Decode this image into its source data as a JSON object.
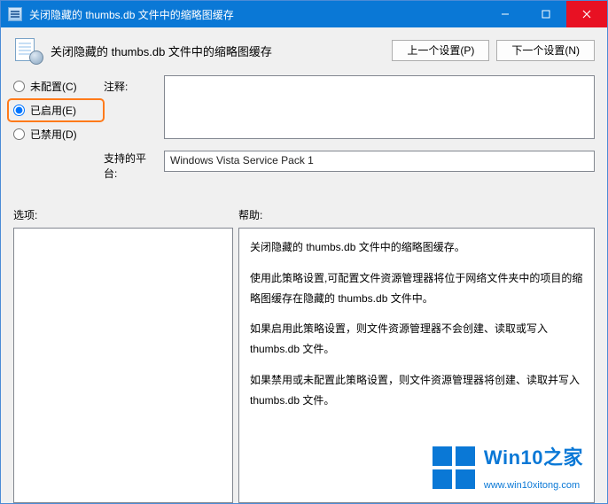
{
  "window": {
    "title": "关闭隐藏的 thumbs.db 文件中的缩略图缓存"
  },
  "header": {
    "title": "关闭隐藏的 thumbs.db 文件中的缩略图缓存",
    "prev_button": "上一个设置(P)",
    "next_button": "下一个设置(N)"
  },
  "radios": {
    "not_configured": "未配置(C)",
    "enabled": "已启用(E)",
    "disabled": "已禁用(D)",
    "selected": "enabled"
  },
  "labels": {
    "comment": "注释:",
    "platform": "支持的平台:",
    "options": "选项:",
    "help": "帮助:"
  },
  "comment_value": "",
  "platform_value": "Windows Vista Service Pack 1",
  "help_text": {
    "p1": "关闭隐藏的 thumbs.db 文件中的缩略图缓存。",
    "p2": "使用此策略设置,可配置文件资源管理器将位于网络文件夹中的项目的缩略图缓存在隐藏的 thumbs.db 文件中。",
    "p3": "如果启用此策略设置，则文件资源管理器不会创建、读取或写入 thumbs.db 文件。",
    "p4": "如果禁用或未配置此策略设置，则文件资源管理器将创建、读取并写入 thumbs.db 文件。"
  },
  "watermark": {
    "brand": "Win10之家",
    "url": "www.win10xitong.com"
  }
}
